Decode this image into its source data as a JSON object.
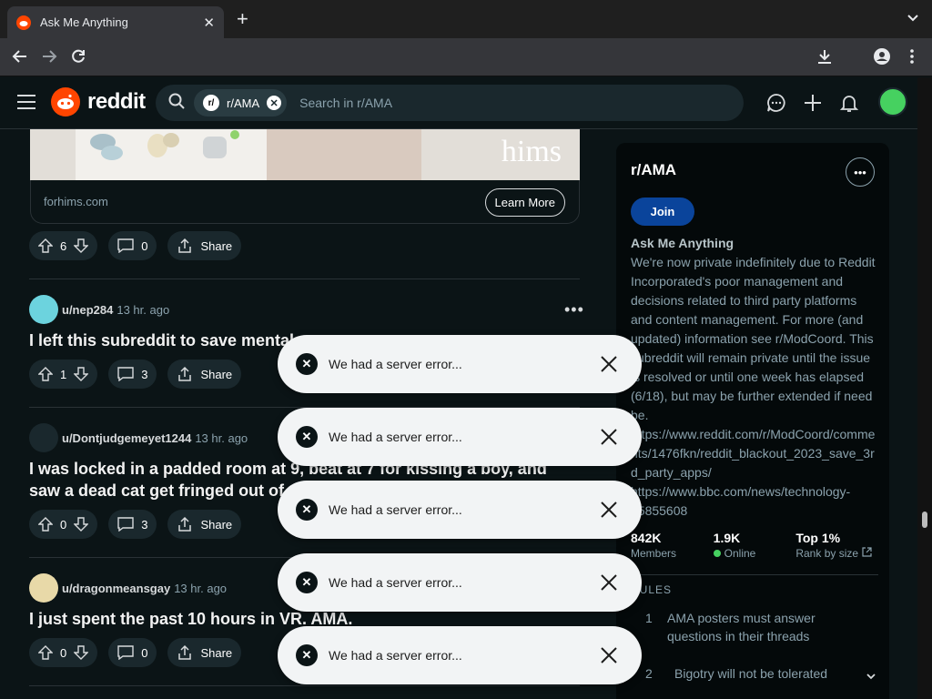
{
  "browser": {
    "tab_title": "Ask Me Anything",
    "tab_close": "✕",
    "new_tab": "+"
  },
  "header": {
    "brand": "reddit",
    "chip_label": "r/AMA",
    "chip_icon": "r/",
    "search_placeholder": "Search in r/AMA"
  },
  "ad": {
    "brand_text": "hims",
    "domain": "forhims.com",
    "cta": "Learn More",
    "votes": "6",
    "comments": "0",
    "share": "Share"
  },
  "posts": [
    {
      "author": "u/nep284",
      "time": "13 hr. ago",
      "title": "I left this subreddit to save mental",
      "votes": "1",
      "comments": "3",
      "share": "Share"
    },
    {
      "author": "u/Dontjudgemeyet1244",
      "time": "13 hr. ago",
      "title": "I was locked in a padded room at 9, beat at 7 for kissing a boy, and saw a dead cat get fringed out of a me",
      "votes": "0",
      "comments": "3",
      "share": "Share"
    },
    {
      "author": "u/dragonmeansgay",
      "time": "13 hr. ago",
      "title": "I just spent the past 10 hours in VR. AMA.",
      "votes": "0",
      "comments": "0",
      "share": "Share"
    }
  ],
  "sidebar": {
    "title": "r/AMA",
    "join": "Join",
    "name": "Ask Me Anything",
    "description": "We're now private indefinitely due to Reddit Incorporated's poor management and decisions related to third party platforms and content management. For more (and updated) information see r/ModCoord. This subreddit will remain private until the issue is resolved or until one week has elapsed (6/18), but may be further extended if need be. https://www.reddit.com/r/ModCoord/comments/1476fkn/reddit_blackout_2023_save_3rd_party_apps/ https://www.bbc.com/news/technology-65855608",
    "members_value": "842K",
    "members_label": "Members",
    "online_value": "1.9K",
    "online_label": "Online",
    "rank_value": "Top 1%",
    "rank_label": "Rank by size",
    "rules_heading": "RULES",
    "rules": [
      {
        "n": "1",
        "text": "AMA posters must answer questions in their threads"
      },
      {
        "n": "2",
        "text": "Bigotry will not be tolerated"
      }
    ]
  },
  "toasts": [
    {
      "message": "We had a server error..."
    },
    {
      "message": "We had a server error..."
    },
    {
      "message": "We had a server error..."
    },
    {
      "message": "We had a server error..."
    },
    {
      "message": "We had a server error..."
    }
  ],
  "colors": {
    "accent": "#ff4500",
    "join": "#0a449b",
    "online": "#46d160"
  }
}
